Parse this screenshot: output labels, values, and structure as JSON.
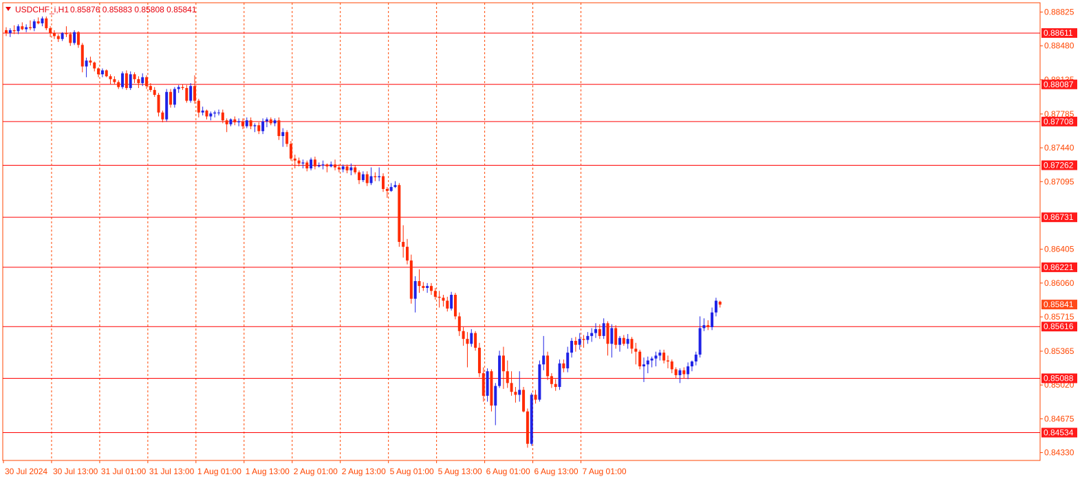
{
  "header": {
    "symbol_text": "USDCHF_i,H1",
    "ohlc_text": "0.85876 0.85883 0.85808 0.85841"
  },
  "colors": {
    "background": "#ffffff",
    "frame": "#ff4500",
    "grid": "#ff4500",
    "bull": "#1e22e6",
    "bear": "#ff2a00",
    "level_line": "#ff0000",
    "label_bg": "#ff1a1a",
    "current_price_bg": "#ff4a1a",
    "axis_text": "#ff4500",
    "header_text": "#e8000c"
  },
  "chart_data": {
    "type": "candlestick",
    "title": "USDCHF_i,H1",
    "timeframe": "H1",
    "last_ohlc": {
      "open": 0.85876,
      "high": 0.85883,
      "low": 0.85808,
      "close": 0.85841
    },
    "current_price": 0.85841,
    "ylim": [
      0.8425,
      0.8892
    ],
    "y_ticks": [
      0.88825,
      0.8848,
      0.88135,
      0.87785,
      0.8744,
      0.87095,
      0.86405,
      0.8606,
      0.85715,
      0.85365,
      0.8502,
      0.84675,
      0.8433
    ],
    "x_ticks": [
      "30 Jul 2024",
      "30 Jul 13:00",
      "31 Jul 01:00",
      "31 Jul 13:00",
      "1 Aug 01:00",
      "1 Aug 13:00",
      "2 Aug 01:00",
      "2 Aug 13:00",
      "5 Aug 01:00",
      "5 Aug 13:00",
      "6 Aug 01:00",
      "6 Aug 13:00",
      "7 Aug 01:00"
    ],
    "horizontal_levels": [
      0.88611,
      0.88087,
      0.87708,
      0.87262,
      0.86731,
      0.86221,
      0.85616,
      0.85088,
      0.84534
    ],
    "vertical_grid": "dashed, every 12 bars",
    "candles": [
      [
        0.8864,
        0.8867,
        0.8858,
        0.8861
      ],
      [
        0.8861,
        0.8866,
        0.8857,
        0.8864
      ],
      [
        0.8864,
        0.8869,
        0.886,
        0.8863
      ],
      [
        0.8863,
        0.887,
        0.886,
        0.8868
      ],
      [
        0.8868,
        0.8872,
        0.8864,
        0.8865
      ],
      [
        0.8865,
        0.887,
        0.8862,
        0.8867
      ],
      [
        0.8867,
        0.8874,
        0.8864,
        0.8866
      ],
      [
        0.8866,
        0.8875,
        0.8863,
        0.8873
      ],
      [
        0.8873,
        0.8877,
        0.887,
        0.8871
      ],
      [
        0.8871,
        0.8878,
        0.8868,
        0.8876
      ],
      [
        0.8876,
        0.8878,
        0.8864,
        0.8866
      ],
      [
        0.8866,
        0.8868,
        0.8857,
        0.8861
      ],
      [
        0.8861,
        0.8864,
        0.8855,
        0.8858
      ],
      [
        0.8858,
        0.886,
        0.8852,
        0.8855
      ],
      [
        0.8855,
        0.8862,
        0.8853,
        0.8861
      ],
      [
        0.8861,
        0.8868,
        0.8857,
        0.886
      ],
      [
        0.886,
        0.8862,
        0.8848,
        0.8851
      ],
      [
        0.8851,
        0.8864,
        0.8849,
        0.8862
      ],
      [
        0.8862,
        0.8863,
        0.8846,
        0.8849
      ],
      [
        0.8849,
        0.8851,
        0.8821,
        0.8827
      ],
      [
        0.8827,
        0.8836,
        0.8816,
        0.8833
      ],
      [
        0.8833,
        0.8837,
        0.8828,
        0.8831
      ],
      [
        0.8831,
        0.8832,
        0.8822,
        0.8825
      ],
      [
        0.8825,
        0.8826,
        0.8816,
        0.8819
      ],
      [
        0.8819,
        0.8825,
        0.8816,
        0.8823
      ],
      [
        0.8823,
        0.8824,
        0.8816,
        0.8817
      ],
      [
        0.8817,
        0.8819,
        0.8809,
        0.8814
      ],
      [
        0.8814,
        0.8817,
        0.8809,
        0.8811
      ],
      [
        0.8811,
        0.8813,
        0.8804,
        0.8806
      ],
      [
        0.8806,
        0.8822,
        0.8804,
        0.882
      ],
      [
        0.882,
        0.8823,
        0.8803,
        0.8805
      ],
      [
        0.8805,
        0.8822,
        0.8803,
        0.8819
      ],
      [
        0.8819,
        0.8821,
        0.881,
        0.8814
      ],
      [
        0.8814,
        0.8817,
        0.8805,
        0.881
      ],
      [
        0.881,
        0.882,
        0.8807,
        0.8816
      ],
      [
        0.8816,
        0.8818,
        0.8804,
        0.8807
      ],
      [
        0.8807,
        0.881,
        0.8801,
        0.8803
      ],
      [
        0.8803,
        0.8806,
        0.8796,
        0.8798
      ],
      [
        0.8798,
        0.88,
        0.8776,
        0.878
      ],
      [
        0.878,
        0.8782,
        0.877,
        0.8773
      ],
      [
        0.8773,
        0.8804,
        0.8771,
        0.8801
      ],
      [
        0.8801,
        0.8804,
        0.8785,
        0.8788
      ],
      [
        0.8788,
        0.8806,
        0.8785,
        0.8804
      ],
      [
        0.8804,
        0.8808,
        0.88,
        0.8806
      ],
      [
        0.8806,
        0.8809,
        0.8803,
        0.8805
      ],
      [
        0.8805,
        0.8808,
        0.879,
        0.8792
      ],
      [
        0.8792,
        0.881,
        0.879,
        0.8807
      ],
      [
        0.8807,
        0.8818,
        0.8789,
        0.8792
      ],
      [
        0.8792,
        0.8794,
        0.8775,
        0.878
      ],
      [
        0.878,
        0.8786,
        0.8777,
        0.8782
      ],
      [
        0.8782,
        0.8783,
        0.8773,
        0.8776
      ],
      [
        0.8776,
        0.8781,
        0.8772,
        0.8779
      ],
      [
        0.8779,
        0.8782,
        0.8775,
        0.878
      ],
      [
        0.878,
        0.8783,
        0.8777,
        0.878
      ],
      [
        0.878,
        0.8783,
        0.8769,
        0.8772
      ],
      [
        0.8772,
        0.8774,
        0.876,
        0.8768
      ],
      [
        0.8768,
        0.8774,
        0.8766,
        0.8773
      ],
      [
        0.8773,
        0.8776,
        0.8767,
        0.877
      ],
      [
        0.877,
        0.8774,
        0.8766,
        0.8771
      ],
      [
        0.8771,
        0.8774,
        0.8763,
        0.8766
      ],
      [
        0.8766,
        0.8775,
        0.8764,
        0.8772
      ],
      [
        0.8772,
        0.8775,
        0.8763,
        0.8766
      ],
      [
        0.8766,
        0.8769,
        0.876,
        0.8767
      ],
      [
        0.8767,
        0.877,
        0.8758,
        0.8761
      ],
      [
        0.8761,
        0.8774,
        0.8758,
        0.8771
      ],
      [
        0.8771,
        0.8775,
        0.8765,
        0.8773
      ],
      [
        0.8773,
        0.8775,
        0.8767,
        0.8769
      ],
      [
        0.8769,
        0.8774,
        0.8766,
        0.8772
      ],
      [
        0.8772,
        0.8775,
        0.8752,
        0.8756
      ],
      [
        0.8756,
        0.8764,
        0.8745,
        0.876
      ],
      [
        0.876,
        0.8762,
        0.8745,
        0.8748
      ],
      [
        0.8748,
        0.8751,
        0.8731,
        0.8733
      ],
      [
        0.8733,
        0.8737,
        0.8723,
        0.8731
      ],
      [
        0.8731,
        0.8734,
        0.8725,
        0.8728
      ],
      [
        0.8728,
        0.8732,
        0.8723,
        0.8729
      ],
      [
        0.8729,
        0.8731,
        0.872,
        0.8723
      ],
      [
        0.8723,
        0.8734,
        0.8721,
        0.8732
      ],
      [
        0.8732,
        0.8735,
        0.8722,
        0.8725
      ],
      [
        0.8725,
        0.8729,
        0.8724,
        0.8726
      ],
      [
        0.8726,
        0.8731,
        0.8722,
        0.8727
      ],
      [
        0.8727,
        0.8728,
        0.8719,
        0.8725
      ],
      [
        0.8725,
        0.873,
        0.8724,
        0.8727
      ],
      [
        0.8727,
        0.8732,
        0.8721,
        0.8724
      ],
      [
        0.8724,
        0.8727,
        0.8719,
        0.8722
      ],
      [
        0.8722,
        0.8727,
        0.8719,
        0.8725
      ],
      [
        0.8725,
        0.8727,
        0.8718,
        0.8721
      ],
      [
        0.8721,
        0.8728,
        0.8716,
        0.8724
      ],
      [
        0.8724,
        0.8726,
        0.8717,
        0.8719
      ],
      [
        0.8719,
        0.8721,
        0.8707,
        0.8711
      ],
      [
        0.8711,
        0.872,
        0.8709,
        0.8717
      ],
      [
        0.8717,
        0.872,
        0.8705,
        0.8708
      ],
      [
        0.8708,
        0.8724,
        0.8706,
        0.8715
      ],
      [
        0.8715,
        0.8719,
        0.871,
        0.8714
      ],
      [
        0.8714,
        0.8724,
        0.871,
        0.8715
      ],
      [
        0.8715,
        0.8718,
        0.8699,
        0.8702
      ],
      [
        0.8702,
        0.8704,
        0.8693,
        0.87
      ],
      [
        0.87,
        0.8708,
        0.8699,
        0.8704
      ],
      [
        0.8704,
        0.871,
        0.8703,
        0.8706
      ],
      [
        0.8706,
        0.8708,
        0.8643,
        0.8648
      ],
      [
        0.8648,
        0.8665,
        0.8632,
        0.8643
      ],
      [
        0.8643,
        0.8651,
        0.8625,
        0.8629
      ],
      [
        0.8629,
        0.8635,
        0.8585,
        0.859
      ],
      [
        0.859,
        0.8613,
        0.8576,
        0.8608
      ],
      [
        0.8608,
        0.862,
        0.8596,
        0.8603
      ],
      [
        0.8603,
        0.8607,
        0.8598,
        0.8601
      ],
      [
        0.8601,
        0.8606,
        0.8596,
        0.8603
      ],
      [
        0.8603,
        0.8606,
        0.8594,
        0.8598
      ],
      [
        0.8598,
        0.8601,
        0.8589,
        0.8592
      ],
      [
        0.8592,
        0.8598,
        0.8581,
        0.8591
      ],
      [
        0.8591,
        0.8594,
        0.8582,
        0.8588
      ],
      [
        0.8588,
        0.8592,
        0.8577,
        0.858
      ],
      [
        0.858,
        0.8597,
        0.8578,
        0.8594
      ],
      [
        0.8594,
        0.8596,
        0.8569,
        0.8572
      ],
      [
        0.8572,
        0.8576,
        0.8552,
        0.8557
      ],
      [
        0.8557,
        0.8561,
        0.8542,
        0.8549
      ],
      [
        0.8549,
        0.8556,
        0.852,
        0.8544
      ],
      [
        0.8544,
        0.8559,
        0.8541,
        0.8555
      ],
      [
        0.8555,
        0.8557,
        0.8537,
        0.854
      ],
      [
        0.854,
        0.8545,
        0.851,
        0.8514
      ],
      [
        0.8514,
        0.852,
        0.8485,
        0.8491
      ],
      [
        0.8491,
        0.8519,
        0.8485,
        0.8516
      ],
      [
        0.8516,
        0.8518,
        0.8475,
        0.8481
      ],
      [
        0.8481,
        0.8504,
        0.8461,
        0.8501
      ],
      [
        0.8501,
        0.8537,
        0.8499,
        0.8532
      ],
      [
        0.8532,
        0.8541,
        0.8498,
        0.8516
      ],
      [
        0.8516,
        0.8527,
        0.8499,
        0.8504
      ],
      [
        0.8504,
        0.8516,
        0.8491,
        0.8495
      ],
      [
        0.8495,
        0.85,
        0.8484,
        0.8492
      ],
      [
        0.8492,
        0.8516,
        0.8485,
        0.8497
      ],
      [
        0.8497,
        0.85,
        0.8474,
        0.8475
      ],
      [
        0.8475,
        0.8478,
        0.8438,
        0.8442
      ],
      [
        0.8442,
        0.8494,
        0.844,
        0.8492
      ],
      [
        0.8492,
        0.8497,
        0.8483,
        0.8487
      ],
      [
        0.8487,
        0.8527,
        0.8485,
        0.8523
      ],
      [
        0.8523,
        0.8552,
        0.8517,
        0.8532
      ],
      [
        0.8532,
        0.8536,
        0.8507,
        0.8511
      ],
      [
        0.8511,
        0.8514,
        0.8499,
        0.8503
      ],
      [
        0.8503,
        0.8508,
        0.8496,
        0.85
      ],
      [
        0.85,
        0.8528,
        0.8497,
        0.8524
      ],
      [
        0.8524,
        0.8528,
        0.8515,
        0.8519
      ],
      [
        0.8519,
        0.8541,
        0.8515,
        0.8535
      ],
      [
        0.8535,
        0.855,
        0.853,
        0.8547
      ],
      [
        0.8547,
        0.8551,
        0.8536,
        0.8543
      ],
      [
        0.8543,
        0.8555,
        0.8538,
        0.8549
      ],
      [
        0.8549,
        0.8553,
        0.854,
        0.8548
      ],
      [
        0.8548,
        0.8556,
        0.8544,
        0.8552
      ],
      [
        0.8552,
        0.856,
        0.8546,
        0.8555
      ],
      [
        0.8555,
        0.8565,
        0.855,
        0.8559
      ],
      [
        0.8559,
        0.8564,
        0.8549,
        0.8552
      ],
      [
        0.8552,
        0.857,
        0.8549,
        0.8565
      ],
      [
        0.8565,
        0.8567,
        0.8532,
        0.8544
      ],
      [
        0.8544,
        0.8564,
        0.853,
        0.856
      ],
      [
        0.856,
        0.8563,
        0.8539,
        0.8543
      ],
      [
        0.8543,
        0.8552,
        0.8536,
        0.855
      ],
      [
        0.855,
        0.8553,
        0.8542,
        0.8544
      ],
      [
        0.8544,
        0.8554,
        0.8539,
        0.8549
      ],
      [
        0.8549,
        0.8551,
        0.8534,
        0.8539
      ],
      [
        0.8539,
        0.8545,
        0.8523,
        0.8536
      ],
      [
        0.8536,
        0.8538,
        0.8518,
        0.8521
      ],
      [
        0.8521,
        0.853,
        0.8505,
        0.8523
      ],
      [
        0.8523,
        0.8531,
        0.8514,
        0.8527
      ],
      [
        0.8527,
        0.8531,
        0.852,
        0.8529
      ],
      [
        0.8529,
        0.8536,
        0.8521,
        0.8532
      ],
      [
        0.8532,
        0.8538,
        0.8527,
        0.8535
      ],
      [
        0.8535,
        0.8538,
        0.8524,
        0.8527
      ],
      [
        0.8527,
        0.8532,
        0.8519,
        0.8526
      ],
      [
        0.8526,
        0.8528,
        0.8514,
        0.8518
      ],
      [
        0.8518,
        0.852,
        0.8509,
        0.8512
      ],
      [
        0.8512,
        0.8519,
        0.8504,
        0.8517
      ],
      [
        0.8517,
        0.852,
        0.8509,
        0.8513
      ],
      [
        0.8513,
        0.8525,
        0.8508,
        0.8521
      ],
      [
        0.8521,
        0.8527,
        0.8516,
        0.8526
      ],
      [
        0.8526,
        0.8536,
        0.8522,
        0.8533
      ],
      [
        0.8533,
        0.8572,
        0.853,
        0.856
      ],
      [
        0.856,
        0.857,
        0.8557,
        0.8563
      ],
      [
        0.8563,
        0.8568,
        0.8558,
        0.8561
      ],
      [
        0.8561,
        0.8581,
        0.8558,
        0.8576
      ],
      [
        0.8576,
        0.8591,
        0.8572,
        0.8588
      ],
      [
        0.8587,
        0.8588,
        0.8581,
        0.8584
      ]
    ]
  }
}
